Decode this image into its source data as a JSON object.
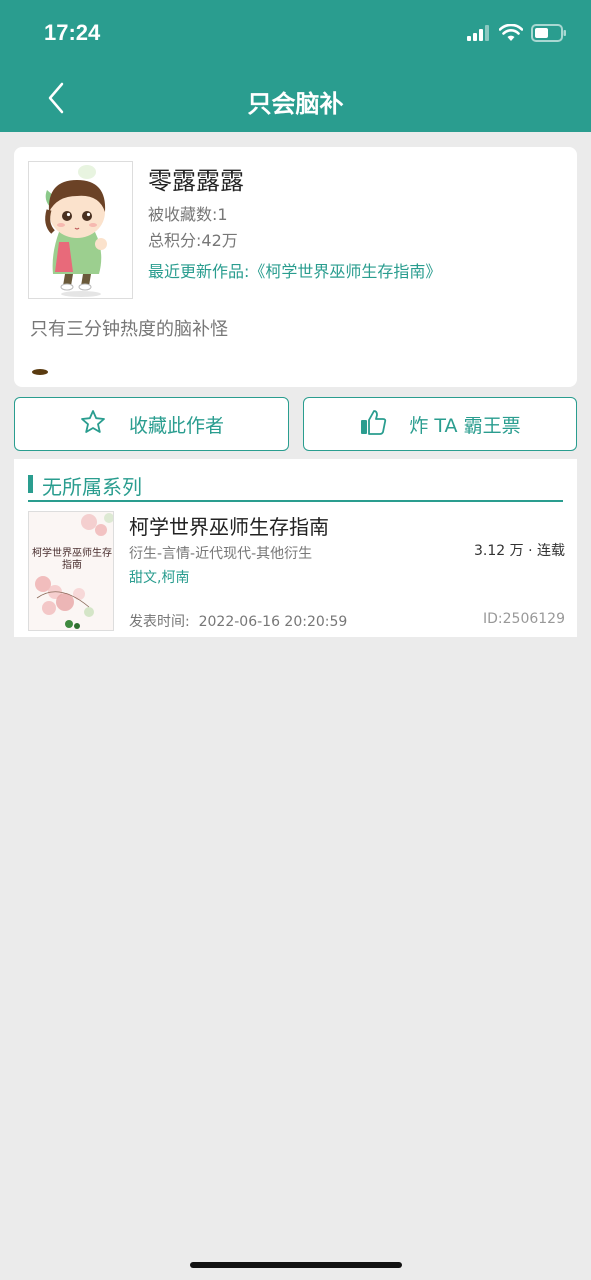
{
  "status_bar": {
    "time": "17:24"
  },
  "nav": {
    "title": "只会脑补"
  },
  "author": {
    "name": "零露露露",
    "favorited": "被收藏数:1",
    "total_score": "总积分:42万",
    "latest_work": "最近更新作品:《柯学世界巫师生存指南》",
    "bio": "只有三分钟热度的脑补怪"
  },
  "actions": {
    "favorite_label": "收藏此作者",
    "vote_label": "炸 TA 霸王票"
  },
  "series": {
    "title": "无所属系列",
    "books": [
      {
        "title": "柯学世界巫师生存指南",
        "cover_text": "柯学世界巫师生存指南",
        "stats": "3.12 万 · 连载",
        "category": "衍生-言情-近代现代-其他衍生",
        "tags": "甜文,柯南",
        "published": "发表时间:  2022-06-16 20:20:59",
        "id": "ID:2506129"
      }
    ]
  },
  "colors": {
    "accent": "#2a9d8f",
    "background": "#ebebeb"
  },
  "icons": [
    "back-chevron-icon",
    "signal-icon",
    "wifi-icon",
    "battery-icon",
    "star-icon",
    "thumbs-up-icon"
  ]
}
